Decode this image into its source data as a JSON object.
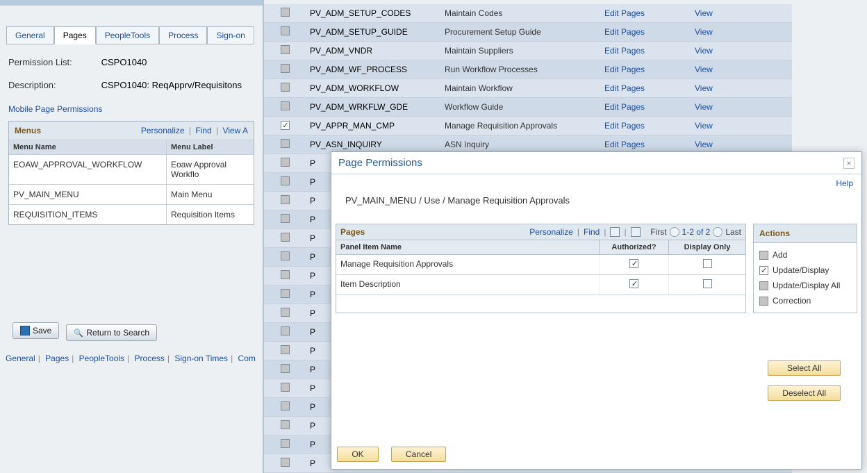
{
  "tabs": [
    {
      "label": "General",
      "accesskey": "G"
    },
    {
      "label": "Pages",
      "accesskey": "a",
      "active": true
    },
    {
      "label": "PeopleTools",
      "accesskey": "e"
    },
    {
      "label": "Process",
      "accesskey": "r"
    },
    {
      "label": "Sign-on",
      "accesskey": "S"
    }
  ],
  "perm_label": "Permission List:",
  "perm_value": "CSPO1040",
  "desc_label": "Description:",
  "desc_value": "CSPO1040: ReqApprv/Requisitons",
  "mobile_link": "Mobile Page Permissions",
  "menu_grid": {
    "title": "Menus",
    "personalize": "Personalize",
    "find": "Find",
    "viewall": "View A",
    "col1": "Menu Name",
    "col2": "Menu Label",
    "rows": [
      {
        "c1": "EOAW_APPROVAL_WORKFLOW",
        "c2": "Eoaw Approval Workflo"
      },
      {
        "c1": "PV_MAIN_MENU",
        "c2": "Main Menu"
      },
      {
        "c1": "REQUISITION_ITEMS",
        "c2": "Requisition Items"
      }
    ]
  },
  "save_btn": "Save",
  "return_btn": "Return to Search",
  "footer_links": [
    "General",
    "Pages",
    "PeopleTools",
    "Process",
    "Sign-on Times",
    "Com"
  ],
  "big_rows": [
    {
      "code": "PV_ADM_SETUP_CODES",
      "desc": "Maintain Codes",
      "edit": "Edit Pages",
      "view": "View",
      "checked": false
    },
    {
      "code": "PV_ADM_SETUP_GUIDE",
      "desc": "Procurement Setup Guide",
      "edit": "Edit Pages",
      "view": "View",
      "checked": false
    },
    {
      "code": "PV_ADM_VNDR",
      "desc": "Maintain Suppliers",
      "edit": "Edit Pages",
      "view": "View",
      "checked": false
    },
    {
      "code": "PV_ADM_WF_PROCESS",
      "desc": "Run Workflow Processes",
      "edit": "Edit Pages",
      "view": "View",
      "checked": false
    },
    {
      "code": "PV_ADM_WORKFLOW",
      "desc": "Maintain Workflow",
      "edit": "Edit Pages",
      "view": "View",
      "checked": false
    },
    {
      "code": "PV_ADM_WRKFLW_GDE",
      "desc": "Workflow Guide",
      "edit": "Edit Pages",
      "view": "View",
      "checked": false
    },
    {
      "code": "PV_APPR_MAN_CMP",
      "desc": "Manage Requisition Approvals",
      "edit": "Edit Pages",
      "view": "View",
      "checked": true
    },
    {
      "code": "PV_ASN_INQUIRY",
      "desc": "ASN Inquiry",
      "edit": "Edit Pages",
      "view": "View",
      "checked": false
    },
    {
      "code": "P",
      "desc": "",
      "edit": "",
      "view": "",
      "checked": false
    },
    {
      "code": "P",
      "desc": "",
      "edit": "",
      "view": "",
      "checked": false
    },
    {
      "code": "P",
      "desc": "",
      "edit": "",
      "view": "",
      "checked": false
    },
    {
      "code": "P",
      "desc": "",
      "edit": "",
      "view": "",
      "checked": false
    },
    {
      "code": "P",
      "desc": "",
      "edit": "",
      "view": "",
      "checked": false
    },
    {
      "code": "P",
      "desc": "",
      "edit": "",
      "view": "",
      "checked": false
    },
    {
      "code": "P",
      "desc": "",
      "edit": "",
      "view": "",
      "checked": false
    },
    {
      "code": "P",
      "desc": "",
      "edit": "",
      "view": "",
      "checked": false
    },
    {
      "code": "P",
      "desc": "",
      "edit": "",
      "view": "",
      "checked": false
    },
    {
      "code": "P",
      "desc": "",
      "edit": "",
      "view": "",
      "checked": false
    },
    {
      "code": "P",
      "desc": "",
      "edit": "",
      "view": "",
      "checked": false
    },
    {
      "code": "P",
      "desc": "",
      "edit": "",
      "view": "",
      "checked": false
    },
    {
      "code": "P",
      "desc": "",
      "edit": "",
      "view": "",
      "checked": false
    },
    {
      "code": "P",
      "desc": "",
      "edit": "",
      "view": "",
      "checked": false
    },
    {
      "code": "P",
      "desc": "",
      "edit": "",
      "view": "",
      "checked": false
    },
    {
      "code": "P",
      "desc": "",
      "edit": "",
      "view": "",
      "checked": false
    },
    {
      "code": "P",
      "desc": "",
      "edit": "",
      "view": "",
      "checked": false
    }
  ],
  "dialog": {
    "title": "Page Permissions",
    "help": "Help",
    "crumb": "PV_MAIN_MENU / Use / Manage Requisition Approvals",
    "pages_title": "Pages",
    "personalize": "Personalize",
    "find": "Find",
    "first": "First",
    "range": "1-2 of 2",
    "last": "Last",
    "col_name": "Panel Item Name",
    "col_auth": "Authorized?",
    "col_disp": "Display Only",
    "rows": [
      {
        "name": "Manage Requisition Approvals",
        "auth": true,
        "disp": false
      },
      {
        "name": "Item Description",
        "auth": true,
        "disp": false
      }
    ],
    "actions_title": "Actions",
    "actions": [
      {
        "label": "Add",
        "checked": false
      },
      {
        "label": "Update/Display",
        "checked": true
      },
      {
        "label": "Update/Display All",
        "checked": false
      },
      {
        "label": "Correction",
        "checked": false
      }
    ],
    "select_all": "Select All",
    "deselect_all": "Deselect All",
    "ok": "OK",
    "cancel": "Cancel"
  }
}
